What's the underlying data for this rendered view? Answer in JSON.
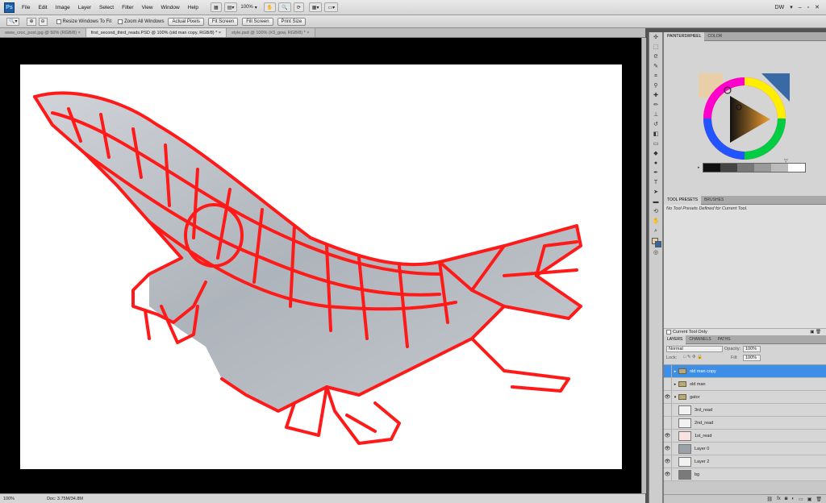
{
  "menubar": {
    "logo": "Ps",
    "items": [
      "File",
      "Edit",
      "Image",
      "Layer",
      "Select",
      "Filter",
      "View",
      "Window",
      "Help"
    ],
    "zoom": "100%",
    "workspace": "DW"
  },
  "options": {
    "resize_windows": "Resize Windows To Fit",
    "zoom_all": "Zoom All Windows",
    "actual_pixels": "Actual Pixels",
    "fit_screen": "Fit Screen",
    "fill_screen": "Fill Screen",
    "print_size": "Print Size"
  },
  "tabs": [
    "www_croc_post.jpg @ 50% (RGB/8)",
    "first_second_third_reads.PSD @ 100% (old man copy, RGB/8) *",
    "style.psd @ 100% (#3_gow, RGB/8) *"
  ],
  "status": {
    "zoom": "100%",
    "doc": "Doc: 3.75M/34.8M"
  },
  "panels": {
    "painter_tab": "PAINTERSWHEEL",
    "color_tab": "COLOR",
    "presets_tab": "TOOL PRESETS",
    "brushes_tab": "BRUSHES",
    "presets_message": "No Tool Presets Defined for Current Tool.",
    "current_tool_only": "Current Tool Only",
    "ramp_colors": [
      "#111111",
      "#444444",
      "#777777",
      "#999999",
      "#bbbbbb",
      "#ffffff"
    ]
  },
  "layers": {
    "tabs": [
      "LAYERS",
      "CHANNELS",
      "PATHS"
    ],
    "blend_mode": "Normal",
    "opacity_label": "Opacity:",
    "opacity": "100%",
    "lock_label": "Lock:",
    "fill_label": "Fill:",
    "fill": "100%",
    "items": [
      {
        "name": "old man copy",
        "type": "folder",
        "visible": false
      },
      {
        "name": "old man",
        "type": "folder",
        "visible": false
      },
      {
        "name": "gator",
        "type": "folder",
        "visible": true
      },
      {
        "name": "3rd_read",
        "type": "layer",
        "visible": false
      },
      {
        "name": "2nd_read",
        "type": "layer",
        "visible": false
      },
      {
        "name": "1st_read",
        "type": "layer",
        "visible": true
      },
      {
        "name": "Layer 0",
        "type": "layer",
        "visible": true
      },
      {
        "name": "Layer 2",
        "type": "layer",
        "visible": true
      },
      {
        "name": "bg",
        "type": "layer",
        "visible": true
      }
    ]
  },
  "colors": {
    "accent": "#3d8ee6",
    "wireframe": "#ff1a1a"
  }
}
